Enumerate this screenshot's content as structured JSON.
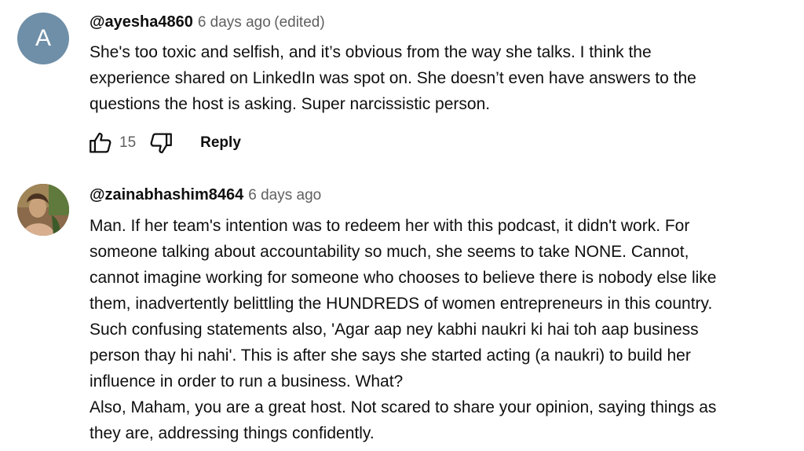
{
  "comments": [
    {
      "avatar_letter": "A",
      "avatar_color": "#6f8fa8",
      "author": "@ayesha4860",
      "timestamp": "6 days ago",
      "edited": "(edited)",
      "lines": [
        "She's too toxic and selfish, and it’s obvious from the way she talks. I think the",
        "experience shared on LinkedIn was spot on. She doesn’t even have answers to the",
        "questions the host is asking. Super narcissistic person."
      ],
      "like_icon": "thumb-up-icon",
      "dislike_icon": "thumb-down-icon",
      "like_count": "15",
      "reply_label": "Reply"
    },
    {
      "author": "@zainabhashim8464",
      "timestamp": "6 days ago",
      "lines": [
        "Man. If her team's intention was to redeem her with this podcast, it didn't work.  For",
        "someone talking about accountability so much, she seems to take NONE. Cannot,",
        "cannot imagine working for someone who chooses to believe there is nobody else like",
        "them,  inadvertently belittling the HUNDREDS of women entrepreneurs in this country.",
        "Such confusing statements also, 'Agar aap ney kabhi naukri ki hai toh aap business",
        "person thay hi nahi'. This is after she says she started acting (a naukri) to build her",
        "influence in order to run a business. What?",
        "Also, Maham, you are a great host. Not scared to share your opinion, saying things as",
        "they are, addressing things confidently."
      ]
    }
  ]
}
